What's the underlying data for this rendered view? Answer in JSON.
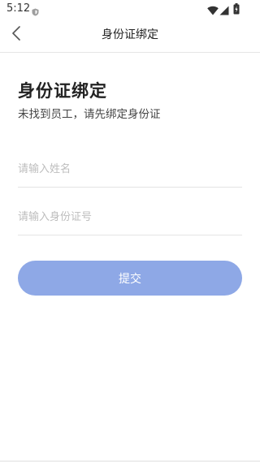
{
  "status_bar": {
    "time": "5:12",
    "icons": [
      "shield-icon",
      "wifi-icon",
      "signal-icon",
      "battery-icon"
    ]
  },
  "nav": {
    "title": "身份证绑定",
    "back_icon": "chevron-left-icon"
  },
  "main": {
    "title": "身份证绑定",
    "subtitle": "未找到员工，请先绑定身份证",
    "name_field": {
      "placeholder": "请输入姓名",
      "value": ""
    },
    "id_field": {
      "placeholder": "请输入身份证号",
      "value": ""
    },
    "submit_label": "提交"
  },
  "colors": {
    "button": "#8ea8e6",
    "button_text": "#ffffff",
    "placeholder": "#bdbdbd",
    "divider": "#e4e4e4"
  }
}
